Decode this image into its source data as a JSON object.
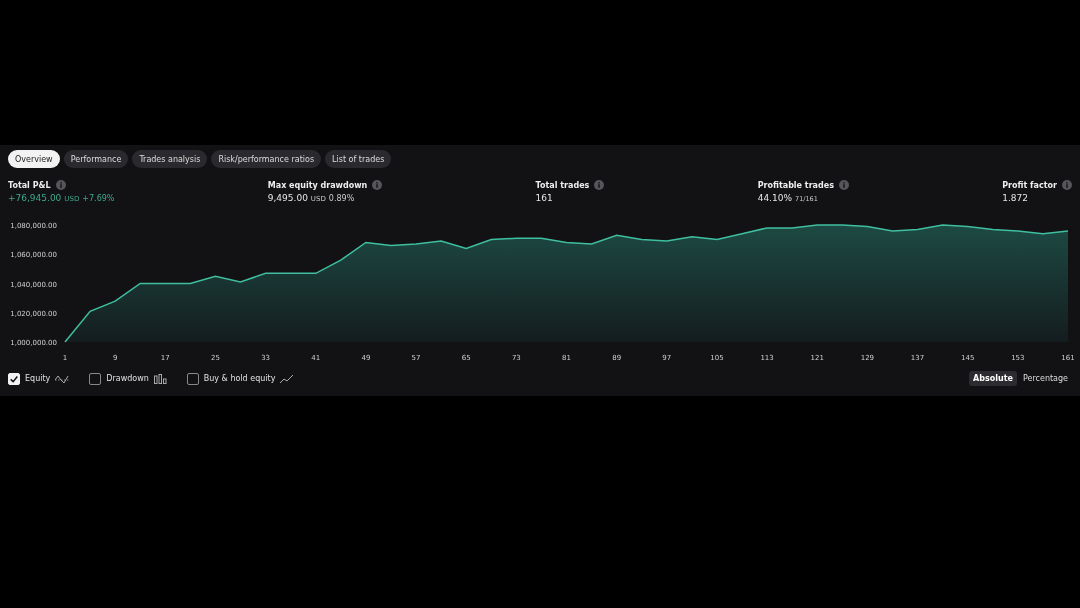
{
  "tabs": [
    {
      "label": "Overview",
      "selected": true
    },
    {
      "label": "Performance",
      "selected": false
    },
    {
      "label": "Trades analysis",
      "selected": false
    },
    {
      "label": "Risk/performance ratios",
      "selected": false
    },
    {
      "label": "List of trades",
      "selected": false
    }
  ],
  "metrics": [
    {
      "label": "Total P&L",
      "value": "+76,945.00",
      "unit": "USD",
      "extra": "+7.69%",
      "positive": true
    },
    {
      "label": "Max equity drawdown",
      "value": "9,495.00",
      "unit": "USD",
      "extra": "0.89%",
      "positive": false
    },
    {
      "label": "Total trades",
      "value": "161",
      "positive": false
    },
    {
      "label": "Profitable trades",
      "value": "44.10%",
      "extra": "71/161",
      "positive": false
    },
    {
      "label": "Profit factor",
      "value": "1.872",
      "positive": false
    }
  ],
  "chart_data": {
    "type": "area",
    "x": [
      1,
      5,
      9,
      13,
      17,
      21,
      25,
      29,
      33,
      37,
      41,
      45,
      49,
      53,
      57,
      61,
      65,
      69,
      73,
      77,
      81,
      85,
      89,
      93,
      97,
      101,
      105,
      109,
      113,
      117,
      121,
      125,
      129,
      133,
      137,
      141,
      145,
      149,
      153,
      157,
      161
    ],
    "series": [
      {
        "color": "#3fbf9f",
        "values": [
          1000000,
          1021000,
          1028000,
          1040000,
          1040000,
          1040000,
          1045000,
          1041000,
          1047000,
          1047000,
          1047000,
          1056000,
          1068000,
          1066000,
          1067000,
          1069000,
          1064000,
          1070000,
          1071000,
          1071000,
          1068000,
          1067000,
          1073000,
          1070000,
          1069000,
          1072000,
          1070000,
          1074000,
          1078000,
          1078000,
          1080000,
          1080000,
          1079000,
          1076000,
          1077000,
          1080000,
          1079000,
          1077000,
          1076000,
          1074000,
          1076000
        ]
      }
    ],
    "ylim": [
      1000000,
      1080000
    ],
    "yticks": [
      {
        "value": 1000000,
        "label": "1,000,000.00"
      },
      {
        "value": 1020000,
        "label": "1,020,000.00"
      },
      {
        "value": 1040000,
        "label": "1,040,000.00"
      },
      {
        "value": 1060000,
        "label": "1,060,000.00"
      },
      {
        "value": 1080000,
        "label": "1,080,000.00"
      }
    ],
    "xlim": [
      1,
      161
    ],
    "xticks": [
      1,
      9,
      17,
      25,
      33,
      41,
      49,
      57,
      65,
      73,
      81,
      89,
      97,
      105,
      113,
      121,
      129,
      137,
      145,
      153,
      161
    ]
  },
  "legend": [
    {
      "label": "Equity",
      "kind": "equity",
      "checked": true
    },
    {
      "label": "Drawdown",
      "kind": "drawdown",
      "checked": false
    },
    {
      "label": "Buy & hold equity",
      "kind": "buyhold",
      "checked": false
    }
  ],
  "modes": [
    {
      "label": "Absolute",
      "selected": true
    },
    {
      "label": "Percentage",
      "selected": false
    }
  ]
}
